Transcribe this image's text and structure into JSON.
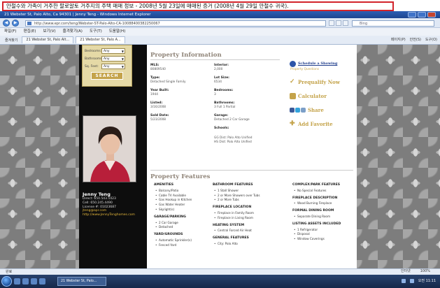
{
  "caption": "안철수와 가족이 거주한 팔로알토 거주지의 주택 매매 정보 - 2008년 5월 23일에 매매된 증거 (2008년 4월 29일 안철수 귀국).",
  "window": {
    "title": "21 Webster St, Palo Alto, Ca 94301 | Jenny Teng - Windows Internet Explorer"
  },
  "address": {
    "url": "http://www.epr.com/teng/Webster-ST-Palo-Alto-CA-10088400382250067",
    "search_placeholder": "Bing"
  },
  "menu": [
    "파일(F)",
    "편집(E)",
    "보기(V)",
    "즐겨찾기(A)",
    "도구(T)",
    "도움말(H)"
  ],
  "tabs": {
    "favorites_label": "즐겨찾기",
    "tab1": "21 Webster St, Palo Alt...",
    "tab2": "21 Webster St, Palo A...",
    "tools": [
      "페이지(P)",
      "안전(S)",
      "도구(O)"
    ]
  },
  "search_form": {
    "rows": [
      {
        "label": "Bedrooms:",
        "value": "Any"
      },
      {
        "label": "Bathrooms:",
        "value": "Any"
      },
      {
        "label": "Sq. Feet:",
        "value": "Any"
      }
    ],
    "button": "SEARCH"
  },
  "agent": {
    "name": "Jenny Teng",
    "direct": "Direct: 650.543.1023",
    "cell": "Cell: 650.245.4490",
    "license": "License #: 01023687",
    "email": "jteng@apr.com",
    "website": "http://www.JennyTenghomes.com"
  },
  "property_info": {
    "title": "Property Information",
    "left": [
      {
        "label": "MLS:",
        "value": "80809540"
      },
      {
        "label": "Type:",
        "value": "Detached Single Family"
      },
      {
        "label": "Year Built:",
        "value": "1944"
      },
      {
        "label": "Listed:",
        "value": "3/16/2008"
      },
      {
        "label": "Sold Date:",
        "value": "5/23/2008"
      }
    ],
    "right": [
      {
        "label": "Interior:",
        "value": "2,000"
      },
      {
        "label": "Lot Size:",
        "value": "6534"
      },
      {
        "label": "Bedrooms:",
        "value": "3"
      },
      {
        "label": "Bathrooms:",
        "value": "3 Full 1 Partial"
      },
      {
        "label": "Garage:",
        "value": "Detached 2 Car Garage"
      },
      {
        "label": "Schools:",
        "value": ""
      }
    ],
    "schools": [
      "GG Dist: Palo Alto Unified",
      "HS Dist: Palo Alto Unified"
    ]
  },
  "actions": {
    "schedule": "Schedule a Showing",
    "questions": "Property Questions",
    "prequalify": "Prequalify Now",
    "calculator": "Calculator",
    "share": "Share",
    "favorite": "Add Favorite"
  },
  "features": {
    "title": "Property Features",
    "col1": [
      {
        "cat": "AMENITIES",
        "items": [
          "Balcony/Patio",
          "Cable TV Available",
          "Gas Hookup in Kitchen",
          "Gas Water Heater",
          "Skylight(s)"
        ]
      },
      {
        "cat": "GARAGE/PARKING",
        "items": [
          "2 Car Garage",
          "Detached"
        ]
      },
      {
        "cat": "YARD/GROUNDS",
        "items": [
          "Automatic Sprinkler(s)",
          "Fenced Yard"
        ]
      }
    ],
    "col2": [
      {
        "cat": "BATHROOM FEATURES",
        "items": [
          "1 Stall Shower",
          "2 or More Showers over Tubs",
          "2 or More Tubs"
        ]
      },
      {
        "cat": "FIREPLACE LOCATION",
        "items": [
          "Fireplace in Family Room",
          "Fireplace in Living Room"
        ]
      },
      {
        "cat": "HEATING SYSTEM",
        "items": [
          "Central Forced Air Heat"
        ]
      },
      {
        "cat": "GENERAL FEATURES",
        "items": [
          "City: Palo Alto"
        ]
      }
    ],
    "col3": [
      {
        "cat": "COMPLEX/PARK FEATURES",
        "items": [
          "No Special Features"
        ]
      },
      {
        "cat": "FIREPLACE DESCRIPTION",
        "items": [
          "Wood Burning Fireplace"
        ]
      },
      {
        "cat": "FORMAL DINING ROOM",
        "items": [
          "Separate Dining Room"
        ]
      },
      {
        "cat": "LISTING ASSETS INCLUDED",
        "items": [
          "1 Refrigerator",
          "Disposal",
          "Window Coverings"
        ]
      }
    ]
  },
  "status": {
    "left": "완료",
    "zone": "인터넷",
    "zoom": "100%"
  },
  "taskbar": {
    "button": "21 Webster St, Palo...",
    "clock": "오전 11:11"
  },
  "colors": {
    "accent_gold": "#c4a34a",
    "heading_taupe": "#8f8478",
    "sidebar_black": "#0d0d0d",
    "caption_border": "#d2232a"
  }
}
